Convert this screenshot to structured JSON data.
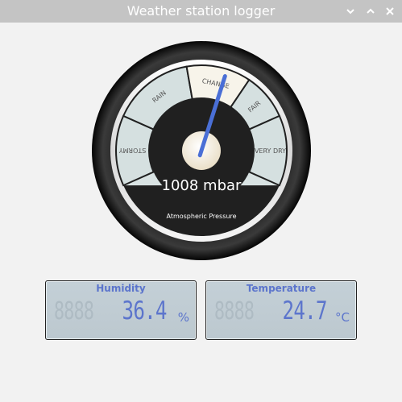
{
  "window": {
    "title": "Weather station logger",
    "controls": [
      "minimize",
      "maximize",
      "close"
    ]
  },
  "barometer": {
    "value": 1008,
    "unit": "mbar",
    "reading_text": "1008 mbar",
    "caption": "Atmospheric Pressure",
    "zones": [
      "STORMY",
      "RAIN",
      "CHANGE",
      "FAIR",
      "VERY DRY"
    ],
    "highlighted_zone": "CHANGE",
    "needle_color": "#4a6fd6"
  },
  "humidity": {
    "title": "Humidity",
    "ghost_digits": "8888",
    "value": "36.4",
    "unit": "%"
  },
  "temperature": {
    "title": "Temperature",
    "ghost_digits": "8888",
    "value": "24.7",
    "unit": "°C"
  },
  "colors": {
    "titlebar": "#c4c4c4",
    "lcd_text": "#5c75cc",
    "lcd_background": "#c4d0d7"
  }
}
